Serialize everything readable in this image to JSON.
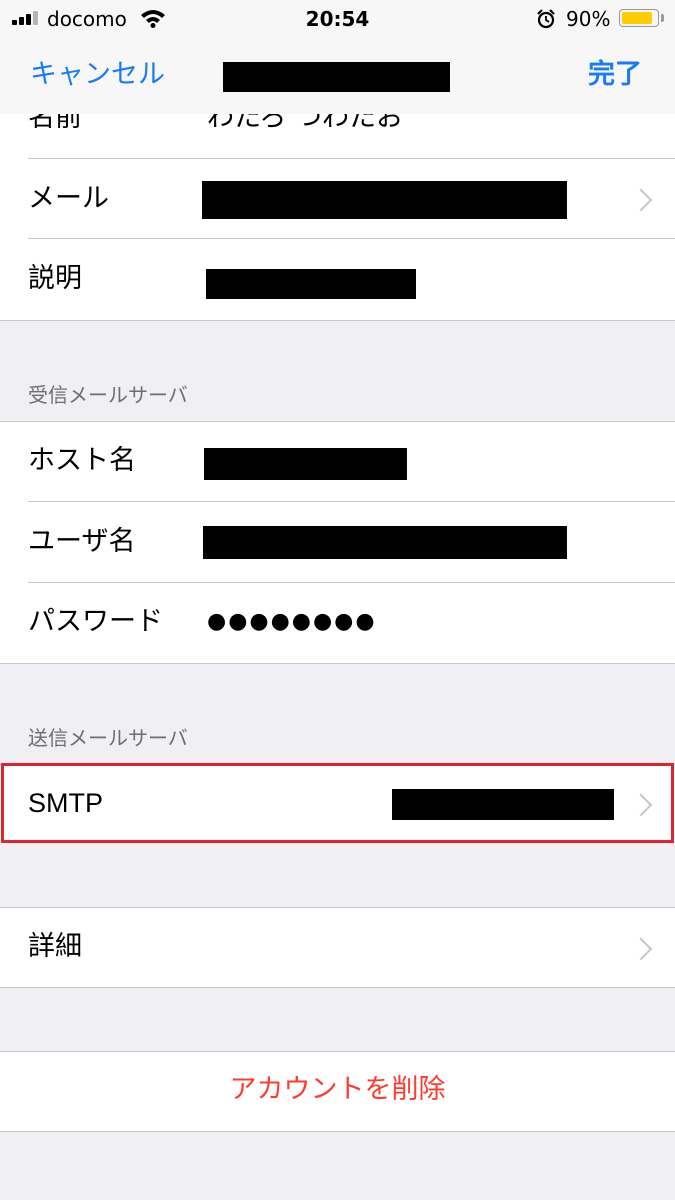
{
  "status_bar": {
    "carrier": "docomo",
    "time": "20:54",
    "battery": "90%",
    "battery_level": 0.9,
    "icons": [
      "signal-icon",
      "wifi-icon",
      "alarm-icon",
      "battery-icon"
    ]
  },
  "nav": {
    "cancel": "キャンセル",
    "done": "完了"
  },
  "account": {
    "name_label": "名前",
    "name_value": "わたろ つわたお",
    "email_label": "メール",
    "description_label": "説明"
  },
  "incoming": {
    "header": "受信メールサーバ",
    "host_label": "ホスト名",
    "user_label": "ユーザ名",
    "password_label": "パスワード",
    "password_value": "●●●●●●●●"
  },
  "outgoing": {
    "header": "送信メールサーバ",
    "smtp_label": "SMTP"
  },
  "advanced": {
    "label": "詳細"
  },
  "delete_account": "アカウントを削除",
  "colors": {
    "accent": "#1a7cf5",
    "destructive": "#ff3b30",
    "highlight": "#e0242e",
    "battery": "#ffcc00"
  }
}
